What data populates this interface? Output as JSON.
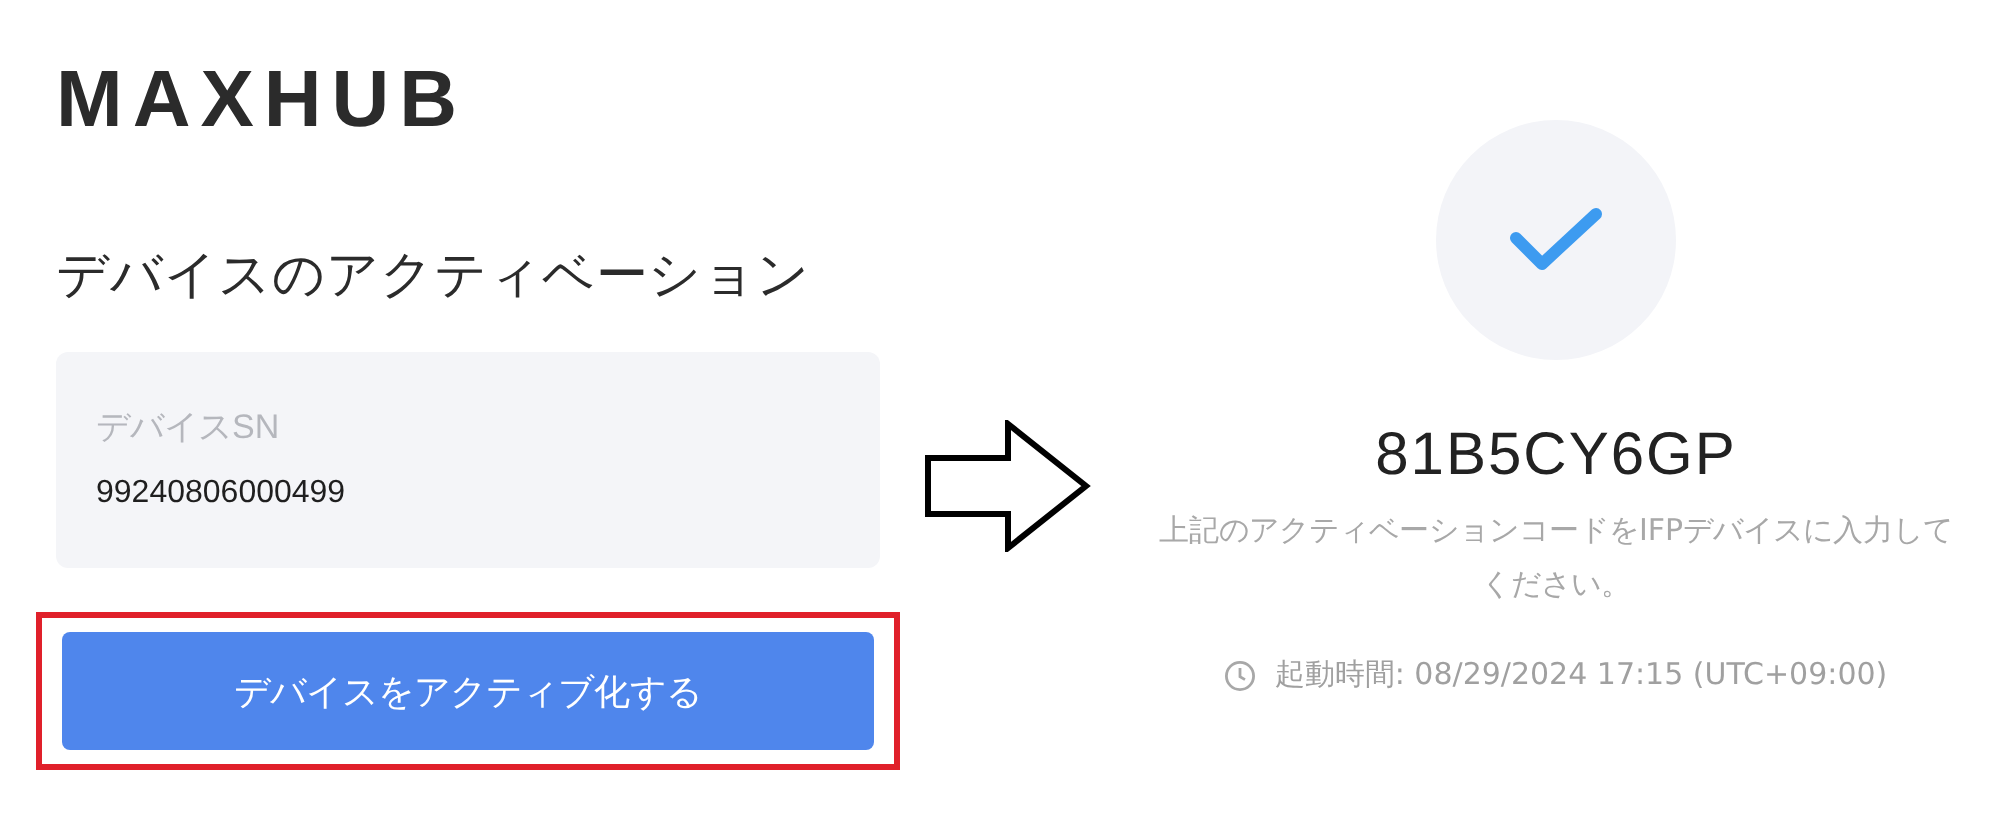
{
  "logo": "MAXHUB",
  "title": "デバイスのアクティベーション",
  "serial_field": {
    "label": "デバイスSN",
    "value": "99240806000499"
  },
  "activate_button": {
    "label": "デバイスをアクティブ化する",
    "highlighted": true
  },
  "result": {
    "success": true,
    "code": "81B5CY6GP",
    "message": "上記のアクティベーションコードをIFPデバイスに入力してください。",
    "time": "起動時間: 08/29/2024 17:15 (UTC+09:00)"
  }
}
